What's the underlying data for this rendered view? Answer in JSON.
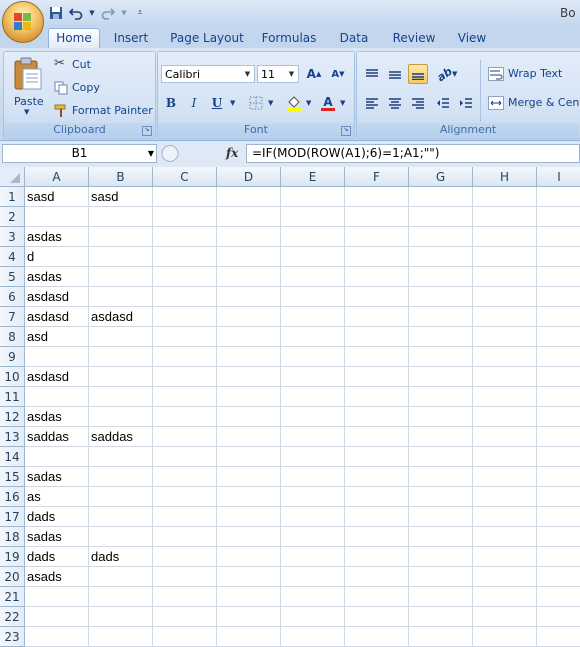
{
  "window": {
    "title": "Bo"
  },
  "qat": {
    "save_icon": "save-icon",
    "undo_icon": "undo-icon",
    "redo_icon": "redo-icon",
    "customize_icon": "chevron-down-icon"
  },
  "tabs": [
    "Home",
    "Insert",
    "Page Layout",
    "Formulas",
    "Data",
    "Review",
    "View"
  ],
  "active_tab": "Home",
  "ribbon": {
    "clipboard": {
      "label": "Clipboard",
      "paste": "Paste",
      "cut": "Cut",
      "copy": "Copy",
      "format_painter": "Format Painter"
    },
    "font": {
      "label": "Font",
      "font_name": "Calibri",
      "font_size": "11",
      "bold": "B",
      "italic": "I",
      "underline": "U"
    },
    "alignment": {
      "label": "Alignment",
      "wrap_text": "Wrap Text",
      "merge_center": "Merge & Cent"
    }
  },
  "formula_bar": {
    "name_box": "B1",
    "fx": "fx",
    "formula": "=IF(MOD(ROW(A1);6)=1;A1;\"\")"
  },
  "grid": {
    "columns": [
      "A",
      "B",
      "C",
      "D",
      "E",
      "F",
      "G",
      "H",
      "I"
    ],
    "rows": [
      [
        "1",
        "sasd",
        "sasd"
      ],
      [
        "2",
        "",
        ""
      ],
      [
        "3",
        "asdas",
        ""
      ],
      [
        "4",
        "d",
        ""
      ],
      [
        "5",
        "asdas",
        ""
      ],
      [
        "6",
        "asdasd",
        ""
      ],
      [
        "7",
        "asdasd",
        "asdasd"
      ],
      [
        "8",
        "asd",
        ""
      ],
      [
        "9",
        "",
        ""
      ],
      [
        "10",
        "asdasd",
        ""
      ],
      [
        "11",
        "",
        ""
      ],
      [
        "12",
        "asdas",
        ""
      ],
      [
        "13",
        "saddas",
        "saddas"
      ],
      [
        "14",
        "",
        ""
      ],
      [
        "15",
        "sadas",
        ""
      ],
      [
        "16",
        "as",
        ""
      ],
      [
        "17",
        "dads",
        ""
      ],
      [
        "18",
        "sadas",
        ""
      ],
      [
        "19",
        "dads",
        "dads"
      ],
      [
        "20",
        "asads",
        ""
      ],
      [
        "21",
        "",
        ""
      ],
      [
        "22",
        "",
        ""
      ],
      [
        "23",
        "",
        ""
      ]
    ]
  }
}
